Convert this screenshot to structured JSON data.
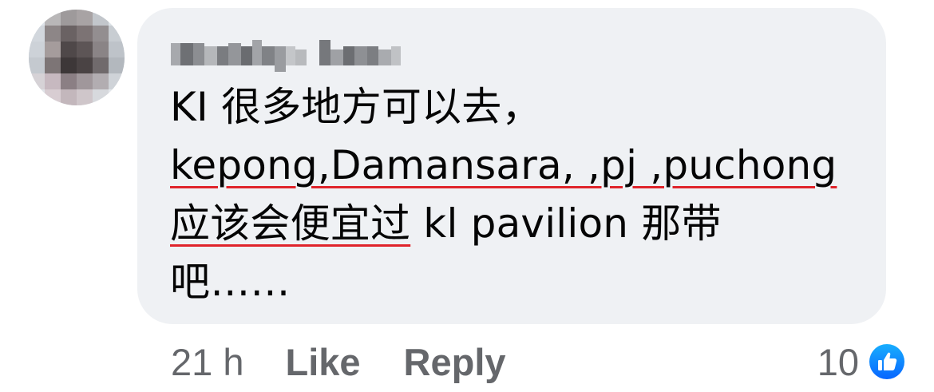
{
  "comment": {
    "text_lines": [
      "KI 很多地方可以去，",
      "kepong,Damansara, ,pj ,puchong",
      "应该会便宜过",
      " kl pavilion 那带",
      "吧……"
    ],
    "underline_color": "#e0242b"
  },
  "actions": {
    "timestamp": "21 h",
    "like_label": "Like",
    "reply_label": "Reply"
  },
  "reactions": {
    "count": "10",
    "icon": "like-thumb-icon",
    "icon_color": "#1877f2"
  },
  "colors": {
    "bubble": "#eff1f4",
    "text": "#050505",
    "secondary_text": "#65676b"
  }
}
